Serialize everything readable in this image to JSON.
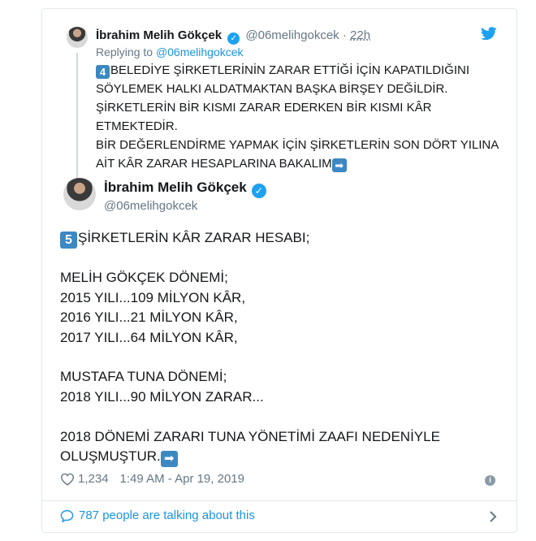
{
  "parent_tweet": {
    "name": "İbrahim Melih Gökçek",
    "handle": "@06melihgokcek",
    "separator": "·",
    "time": "22h",
    "reply_prefix": "Replying to",
    "reply_handle": "@06melihgokcek",
    "number_emoji": "4",
    "text": "BELEDİYE ŞİRKETLERİNİN ZARAR ETTİĞİ İÇİN KAPATILDIĞINI SÖYLEMEK HALKI ALDATMAKTAN BAŞKA BİRŞEY DEĞİLDİR.\nŞİRKETLERİN BİR KISMI ZARAR EDERKEN BİR KISMI KÂR ETMEKTEDİR.\nBİR DEĞERLENDİRME YAPMAK İÇİN ŞİRKETLERİN SON DÖRT YILINA AİT KÂR ZARAR HESAPLARINA BAKALIM",
    "arrow_emoji": "➡"
  },
  "main_tweet": {
    "name": "İbrahim Melih Gökçek",
    "handle": "@06melihgokcek",
    "number_emoji": "5",
    "text": "ŞİRKETLERİN KÂR ZARAR HESABI;\n\nMELİH GÖKÇEK DÖNEMİ;\n2015 YILI...109 MİLYON KÂR,\n2016 YILI...21    MİLYON KÂR,\n2017 YILI...64    MİLYON KÂR,\n\nMUSTAFA TUNA DÖNEMİ;\n2018 YILI...90 MİLYON ZARAR...\n\n2018 DÖNEMİ ZARARI TUNA YÖNETİMİ ZAAFI NEDENİYLE OLUŞMUŞTUR.",
    "arrow_emoji": "➡",
    "likes": "1,234",
    "timestamp": "1:49 AM - Apr 19, 2019"
  },
  "footer": {
    "talking": "787 people are talking about this"
  },
  "colors": {
    "accent": "#1da1f2",
    "link": "#1b95e0",
    "muted": "#657786",
    "emoji_box": "#3b88c3"
  },
  "icons": [
    "verified-icon",
    "twitter-bird-icon",
    "heart-icon",
    "info-icon",
    "comment-bubble-icon",
    "chevron-right-icon"
  ]
}
